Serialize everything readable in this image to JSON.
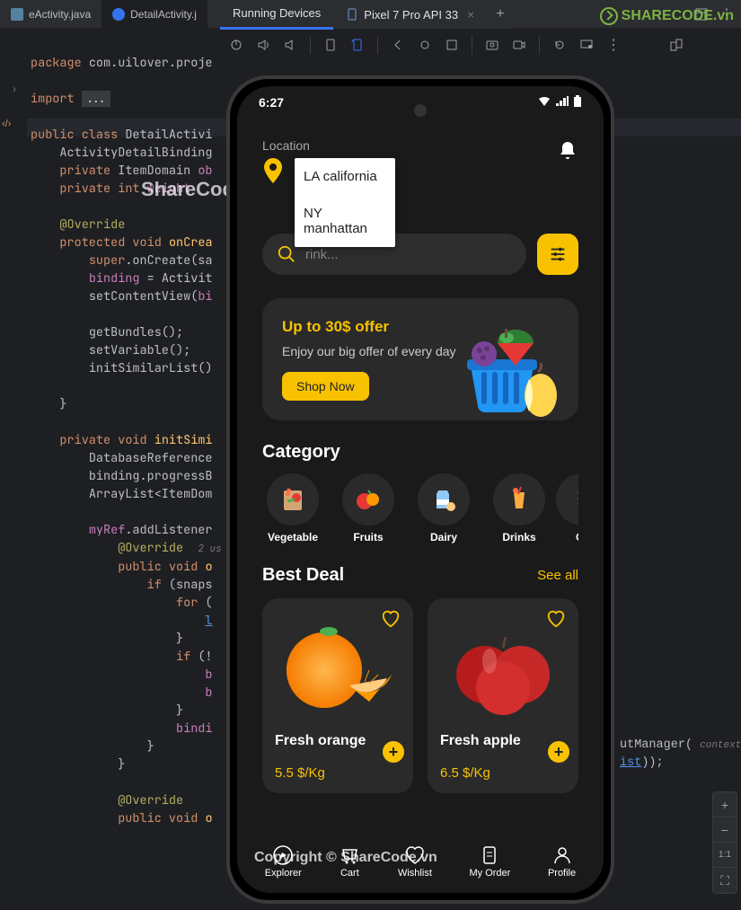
{
  "editor_tabs": [
    {
      "label": "eActivity.java",
      "active": false
    },
    {
      "label": "DetailActivity.j",
      "active": true
    }
  ],
  "device_panel": {
    "title": "Running Devices",
    "device_tab": "Pixel 7 Pro API 33"
  },
  "logo_text": "SHARECODE.vn",
  "watermark": "ShareCode.Vn",
  "copyright": "Copyright © ShareCode.vn",
  "code": {
    "l1_package": "package",
    "l1_path": "com.uilover.proje",
    "l2_import": "import",
    "l2_dots": "...",
    "l3_public": "public",
    "l3_class": "class",
    "l3_name": "DetailActivi",
    "l4": "ActivityDetailBinding",
    "l5_private": "private",
    "l5_type": "ItemDomain",
    "l5_var": "ob",
    "l6_private": "private",
    "l6_type": "int",
    "l6_var": "weight",
    "l7_override": "@Override",
    "l8_protected": "protected",
    "l8_void": "void",
    "l8_name": "onCrea",
    "l9_super": "super",
    "l9_call": ".onCreate(sa",
    "l10_var": "binding",
    "l10_eq": " = Activit",
    "l11_call": "setContentView(",
    "l11_arg": "bi",
    "l12": "getBundles();",
    "l13": "setVariable();",
    "l14": "initSimilarList()",
    "l15": "}",
    "l16_private": "private",
    "l16_void": "void",
    "l16_name": "initSimi",
    "l17": "DatabaseReference",
    "l18": "binding.progressB",
    "l19": "ArrayList<ItemDom",
    "l20_var": "myRef",
    "l20_call": ".addListener",
    "l21_override": "@Override",
    "l21_hint": "2 us",
    "l22_public": "public",
    "l22_void": "void",
    "l22_name": "o",
    "l23_if": "if",
    "l23_cond": "(snaps",
    "l24_for": "for",
    "l24_paren": "(",
    "l25_link": "l",
    "l26": "}",
    "l27_if": "if",
    "l27_cond": "(!",
    "l28": "b",
    "l29": "b",
    "l30": "}",
    "l31": "bindi",
    "l32": "}",
    "l33": "}",
    "l34_override": "@Override",
    "l35_public": "public",
    "l35_void": "void",
    "l35_name": "o",
    "tail1_a": "utManager(",
    "tail1_b": "context",
    "tail2_a": "ist",
    "tail2_b": "));"
  },
  "phone": {
    "time": "6:27",
    "location_label": "Location",
    "dropdown": [
      "LA california",
      "NY manhattan"
    ],
    "search_placeholder": "rink...",
    "offer_title": "Up to 30$ offer",
    "offer_text": "Enjoy our big offer of every day",
    "shop_now": "Shop Now",
    "category_title": "Category",
    "categories": [
      "Vegetable",
      "Fruits",
      "Dairy",
      "Drinks",
      "Gr"
    ],
    "best_deal": "Best Deal",
    "see_all": "See all",
    "deals": [
      {
        "name": "Fresh orange",
        "price": "5.5 $/Kg"
      },
      {
        "name": "Fresh apple",
        "price": "6.5 $/Kg"
      }
    ],
    "nav": [
      "Explorer",
      "Cart",
      "Wishlist",
      "My Order",
      "Profile"
    ]
  },
  "zoom": {
    "plus": "+",
    "minus": "−",
    "fit": "1:1",
    "reset": "⛶"
  }
}
